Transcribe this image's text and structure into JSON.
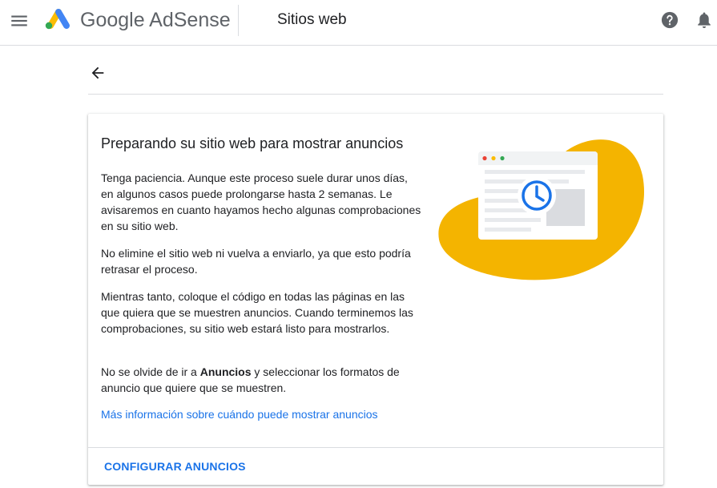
{
  "header": {
    "product_name": "Google AdSense",
    "section_title": "Sitios web",
    "icons": [
      "menu-icon",
      "adsense-logo-icon",
      "help-icon",
      "notifications-bell-icon"
    ]
  },
  "navigation": {
    "back_icon": "arrow-back-icon"
  },
  "card": {
    "title": "Preparando su sitio web para mostrar anuncios",
    "paragraphs": [
      "Tenga paciencia. Aunque este proceso suele durar unos días, en algunos casos puede prolongarse hasta 2 semanas. Le avisaremos en cuanto hayamos hecho algunas comprobaciones en su sitio web.",
      "No elimine el sitio web ni vuelva a enviarlo, ya que esto podría retrasar el proceso.",
      "Mientras tanto, coloque el código en todas las páginas en las que quiera que se muestren anuncios. Cuando terminemos las comprobaciones, su sitio web estará listo para mostrarlos."
    ],
    "last_paragraph": {
      "before": "No se olvide de ir a ",
      "bold": "Anuncios",
      "after": " y seleccionar los formatos de anuncio que quiere que se muestren."
    },
    "learn_more_link": "Más información sobre cuándo puede mostrar anuncios",
    "action_button": "CONFIGURAR ANUNCIOS",
    "illustration_icon": "browser-clock-illustration"
  },
  "colors": {
    "accent": "#1a73e8",
    "illustration_yellow": "#f4b400",
    "divider": "#dadce0"
  }
}
